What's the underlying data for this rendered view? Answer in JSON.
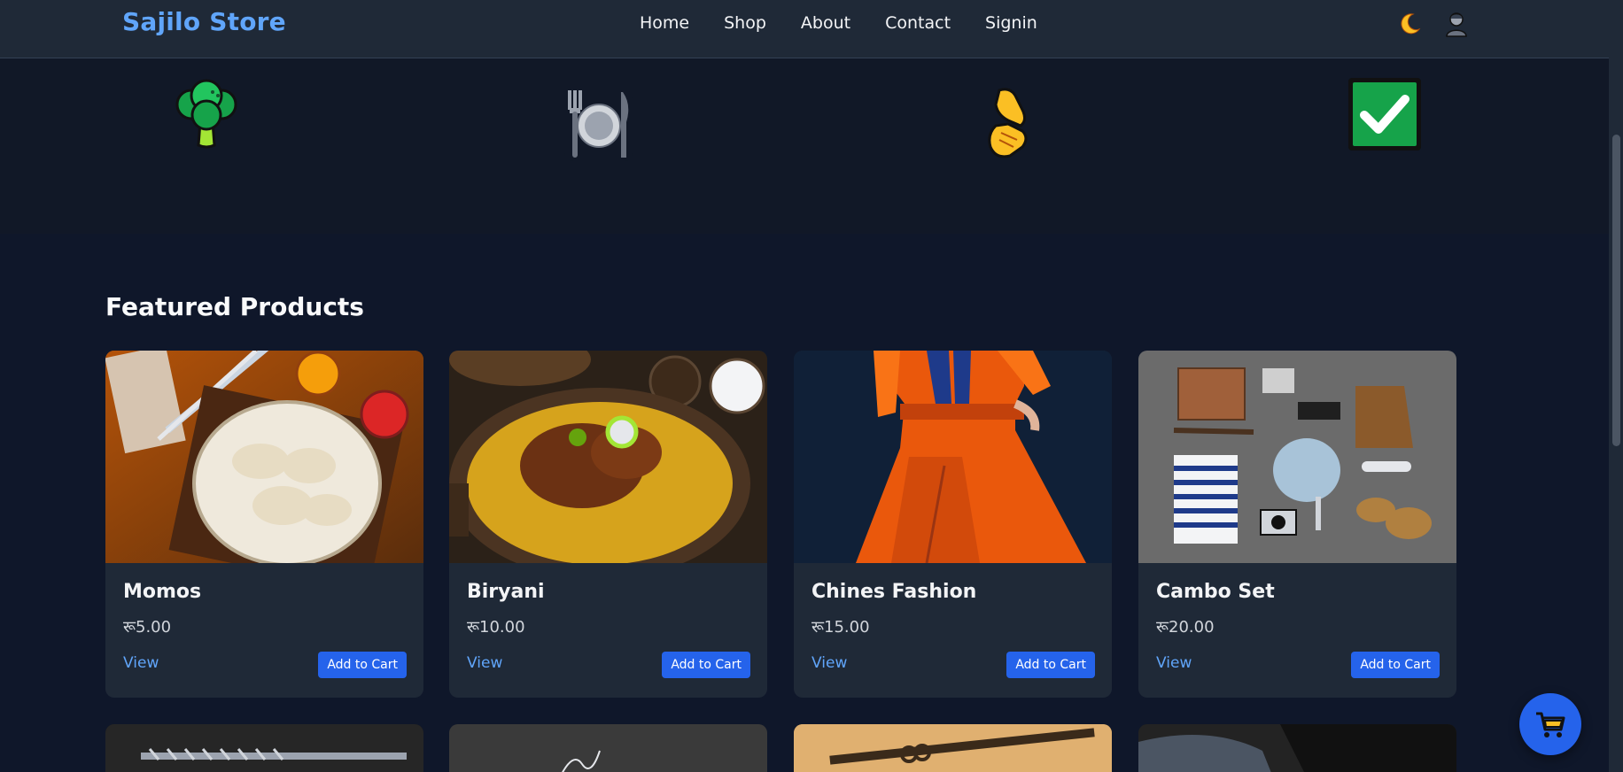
{
  "header": {
    "brand": "Sajilo Store",
    "nav": [
      {
        "label": "Home"
      },
      {
        "label": "Shop"
      },
      {
        "label": "About"
      },
      {
        "label": "Contact"
      },
      {
        "label": "Signin"
      }
    ],
    "icons": [
      "moon-icon",
      "user-avatar-icon"
    ]
  },
  "features": {
    "icons": [
      "broccoli-icon",
      "plate-cutlery-icon",
      "handshake-icon",
      "check-mark-icon"
    ]
  },
  "featured": {
    "title": "Featured Products",
    "products": [
      {
        "name": "Momos",
        "price": "रू5.00",
        "view_label": "View",
        "add_label": "Add to Cart"
      },
      {
        "name": "Biryani",
        "price": "रू10.00",
        "view_label": "View",
        "add_label": "Add to Cart"
      },
      {
        "name": "Chines Fashion",
        "price": "रू15.00",
        "view_label": "View",
        "add_label": "Add to Cart"
      },
      {
        "name": "Cambo Set",
        "price": "रू20.00",
        "view_label": "View",
        "add_label": "Add to Cart"
      }
    ]
  },
  "colors": {
    "background": "#0f172a",
    "header": "#1f2937",
    "brand": "#60a5fa",
    "accent": "#2563eb",
    "card": "#1f2937"
  },
  "fab": {
    "icon": "shopping-cart-icon"
  }
}
